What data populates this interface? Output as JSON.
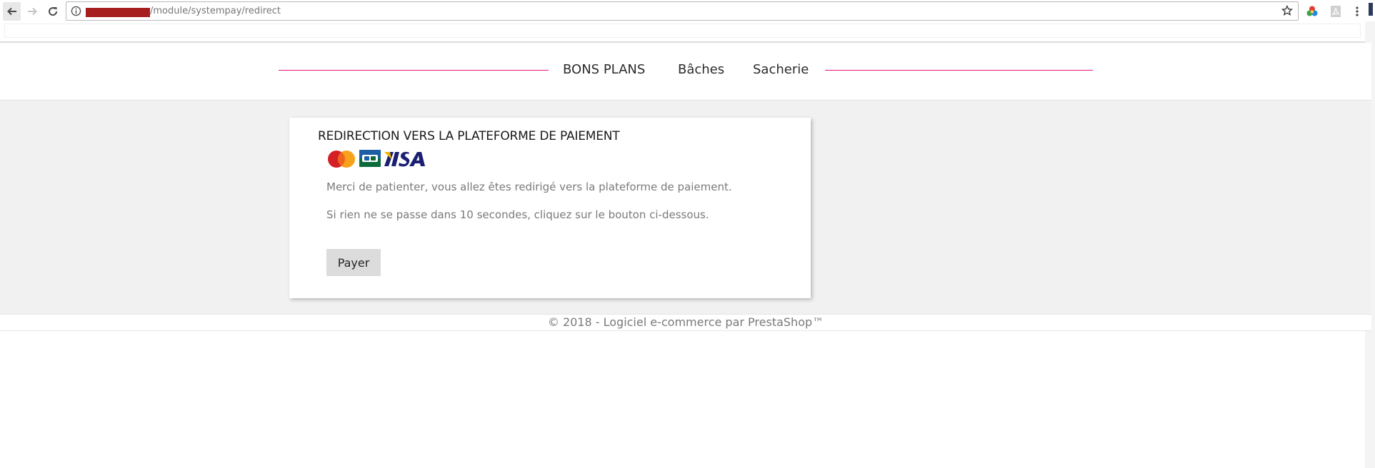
{
  "browser": {
    "url_path": "/module/systempay/redirect",
    "icons": {
      "back": "arrow-left-icon",
      "forward": "arrow-right-icon",
      "reload": "reload-icon",
      "info": "info-icon",
      "bookmark": "star-icon",
      "extension_color": "color-picker-icon",
      "extension_pdf": "pdf-icon",
      "menu": "kebab-menu-icon"
    }
  },
  "header": {
    "menu": [
      {
        "label": "BONS PLANS"
      },
      {
        "label": "Bâches"
      },
      {
        "label": "Sacherie"
      }
    ],
    "accent_color": "#e0177e"
  },
  "payment": {
    "title": "REDIRECTION VERS LA PLATEFORME DE PAIEMENT",
    "logos": [
      "MasterCard",
      "CB",
      "VISA"
    ],
    "message_wait": "Merci de patienter, vous allez êtes redirigé vers la plateforme de paiement.",
    "message_fallback": "Si rien ne se passe dans 10 secondes, cliquez sur le bouton ci-dessous.",
    "button_label": "Payer"
  },
  "footer": {
    "text": "© 2018 - Logiciel e-commerce par PrestaShop™"
  }
}
